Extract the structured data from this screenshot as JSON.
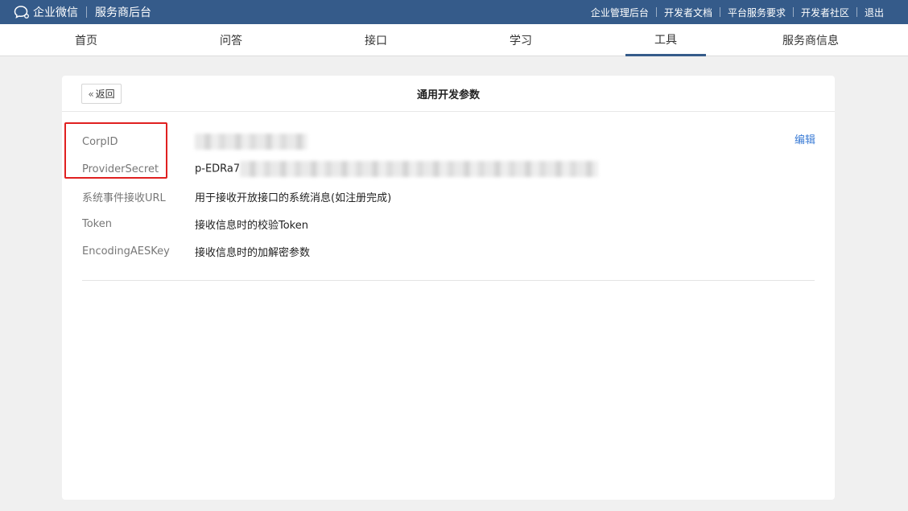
{
  "topbar": {
    "brand_name": "企业微信",
    "brand_sub": "服务商后台",
    "links": [
      "企业管理后台",
      "开发者文档",
      "平台服务要求",
      "开发者社区",
      "退出"
    ]
  },
  "nav": {
    "tabs": [
      "首页",
      "问答",
      "接口",
      "学习",
      "工具",
      "服务商信息"
    ],
    "active": "工具"
  },
  "card": {
    "back_label": "返回",
    "title": "通用开发参数",
    "edit_label": "编辑",
    "params": [
      {
        "label": "CorpID",
        "value": ""
      },
      {
        "label": "ProviderSecret",
        "value": "p-EDRa7"
      },
      {
        "label": "系统事件接收URL",
        "value": "用于接收开放接口的系统消息(如注册完成)"
      },
      {
        "label": "Token",
        "value": "接收信息时的校验Token"
      },
      {
        "label": "EncodingAESKey",
        "value": "接收信息时的加解密参数"
      }
    ]
  },
  "colors": {
    "topbar_bg": "#355b8a",
    "link_blue": "#3a7bd5",
    "highlight_red": "#e02020"
  }
}
